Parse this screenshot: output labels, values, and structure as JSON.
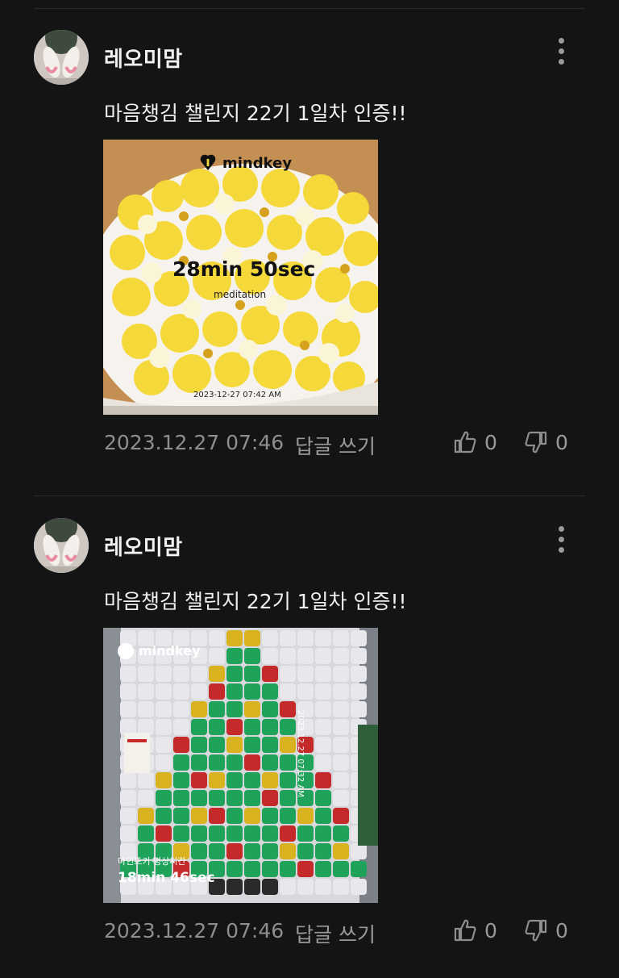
{
  "posts": [
    {
      "author": "레오미맘",
      "content": "마음챙김 챌린지 22기 1일차 인증!!",
      "image": {
        "brand": "mindkey",
        "duration": "28min 50sec",
        "activity": "meditation",
        "captured_at": "2023-12-27 07:42 AM"
      },
      "timestamp": "2023.12.27 07:46",
      "reply_label": "답글 쓰기",
      "likes": "0",
      "dislikes": "0"
    },
    {
      "author": "레오미맘",
      "content": "마음챙김 챌린지 22기 1일차 인증!!",
      "image": {
        "brand": "mindkey",
        "duration": "18min 46sec",
        "activity": "마인드키 명상시간",
        "captured_at": "2023.12.27 07:32 AM"
      },
      "timestamp": "2023.12.27 07:46",
      "reply_label": "답글 쓰기",
      "likes": "0",
      "dislikes": "0"
    }
  ],
  "colors": {
    "background": "#141414",
    "text": "#f0f0f0",
    "muted": "#8e8e8e"
  }
}
